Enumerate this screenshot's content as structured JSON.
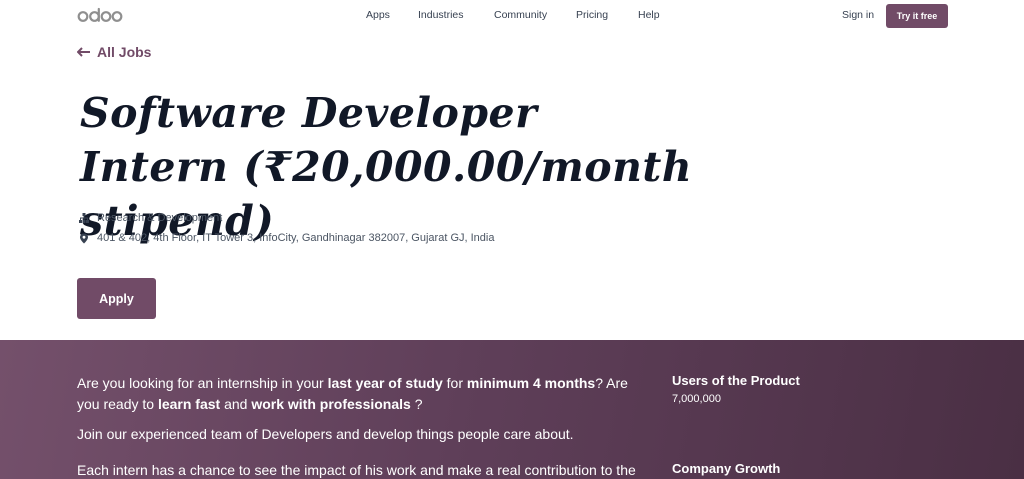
{
  "header": {
    "logo_text": "odoo",
    "nav": [
      "Apps",
      "Industries",
      "Community",
      "Pricing",
      "Help"
    ],
    "sign_in": "Sign in",
    "try_button": "Try it free"
  },
  "back_link": "All Jobs",
  "job": {
    "title": "Software Developer Intern (₹20,000.00/month stipend)",
    "department": "Research & Development",
    "address": "401 & 402, 4th Floor, IT Tower 3, InfoCity, Gandhinagar 382007, Gujarat GJ, India",
    "apply_label": "Apply"
  },
  "description": {
    "p1": {
      "t1": "Are you looking for an internship in your ",
      "b1": "last year of study",
      "t2": " for ",
      "b2": "minimum 4 months",
      "t3": "? Are you ready to ",
      "b3": "learn fast",
      "t4": " and ",
      "b4": "work with professionals",
      "t5": " ?"
    },
    "p2": "Join our experienced team of Developers and develop things people care about.",
    "p3": "Each intern has a chance to see the impact of his work and make a real contribution to the"
  },
  "stats": [
    {
      "label": "Users of the Product",
      "value": "7,000,000"
    },
    {
      "label": "Company Growth",
      "value": ""
    }
  ],
  "colors": {
    "brand": "#714b67",
    "section_bg": "#5f3f59"
  }
}
